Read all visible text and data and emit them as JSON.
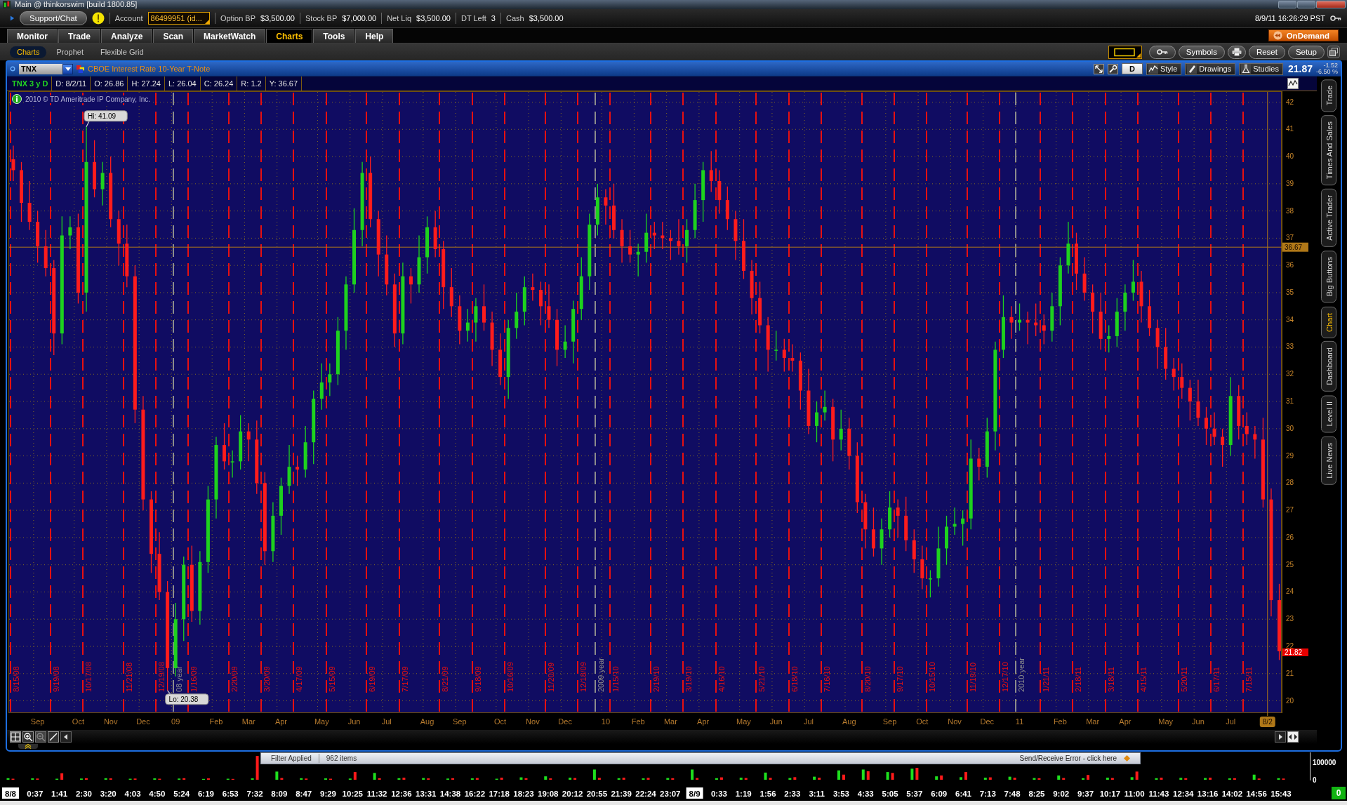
{
  "window": {
    "title": "Main @ thinkorswim [build 1800.85]"
  },
  "account_bar": {
    "support_button": "Support/Chat",
    "account_label": "Account",
    "account_value": "86499951 (id...",
    "stats": [
      {
        "label": "Option BP",
        "value": "$3,500.00"
      },
      {
        "label": "Stock BP",
        "value": "$7,000.00"
      },
      {
        "label": "Net Liq",
        "value": "$3,500.00"
      },
      {
        "label": "DT Left",
        "value": "3"
      },
      {
        "label": "Cash",
        "value": "$3,500.00"
      }
    ],
    "datetime": "8/9/11 16:26:29 PST"
  },
  "tabs": [
    {
      "label": "Monitor",
      "selected": false
    },
    {
      "label": "Trade",
      "selected": false
    },
    {
      "label": "Analyze",
      "selected": false
    },
    {
      "label": "Scan",
      "selected": false
    },
    {
      "label": "MarketWatch",
      "selected": false
    },
    {
      "label": "Charts",
      "selected": true
    },
    {
      "label": "Tools",
      "selected": false
    },
    {
      "label": "Help",
      "selected": false
    }
  ],
  "on_demand_button": "OnDemand",
  "subtabs": [
    {
      "label": "Charts",
      "selected": true
    },
    {
      "label": "Prophet",
      "selected": false
    },
    {
      "label": "Flexible Grid",
      "selected": false
    }
  ],
  "subtab_toolbar": [
    "Symbols",
    "Reset",
    "Setup"
  ],
  "chart_header": {
    "symbol": "TNX",
    "description": "CBOE Interest Rate 10-Year T-Note",
    "aggregation": "D",
    "buttons": [
      {
        "label": "Style",
        "kind": "style"
      },
      {
        "label": "Drawings",
        "kind": "drawings"
      },
      {
        "label": "Studies",
        "kind": "studies"
      }
    ],
    "last_price": "21.87",
    "net_change": "-1.52",
    "percent_change": "-6.50 %"
  },
  "info_bar": {
    "title": "TNX 3 y D",
    "fields": [
      "D: 8/2/11",
      "O: 26.86",
      "H: 27.24",
      "L: 26.04",
      "C: 26.24",
      "R: 1.2",
      "Y: 36.67"
    ]
  },
  "price_chart": {
    "copyright": "2010 © TD Ameritrade IP Company, Inc.",
    "date_lines": [
      {
        "label": "8/15/08",
        "color": "#e81010"
      },
      {
        "label": "9/19/08",
        "color": "#e81010"
      },
      {
        "label": "10/17/08",
        "color": "#e81010"
      },
      {
        "label": "11/21/08",
        "color": "#e81010"
      },
      {
        "label": "12/19/08",
        "color": "#e81010"
      },
      {
        "label": "08 year",
        "color": "#8c8c8c"
      },
      {
        "label": "1/16/09",
        "color": "#e81010"
      },
      {
        "label": "2/20/09",
        "color": "#e81010"
      },
      {
        "label": "3/20/09",
        "color": "#e81010"
      },
      {
        "label": "4/17/09",
        "color": "#e81010"
      },
      {
        "label": "5/15/09",
        "color": "#e81010"
      },
      {
        "label": "6/19/09",
        "color": "#e81010"
      },
      {
        "label": "7/17/09",
        "color": "#e81010"
      },
      {
        "label": "8/21/09",
        "color": "#e81010"
      },
      {
        "label": "9/18/09",
        "color": "#e81010"
      },
      {
        "label": "10/16/09",
        "color": "#e81010"
      },
      {
        "label": "11/20/09",
        "color": "#e81010"
      },
      {
        "label": "12/18/09",
        "color": "#e81010"
      },
      {
        "label": "2009 year",
        "color": "#8c8c8c"
      },
      {
        "label": "1/15/10",
        "color": "#e81010"
      },
      {
        "label": "2/19/10",
        "color": "#e81010"
      },
      {
        "label": "3/19/10",
        "color": "#e81010"
      },
      {
        "label": "4/16/10",
        "color": "#e81010"
      },
      {
        "label": "5/21/10",
        "color": "#e81010"
      },
      {
        "label": "6/18/10",
        "color": "#e81010"
      },
      {
        "label": "7/16/10",
        "color": "#e81010"
      },
      {
        "label": "8/20/10",
        "color": "#e81010"
      },
      {
        "label": "9/17/10",
        "color": "#e81010"
      },
      {
        "label": "10/15/10",
        "color": "#e81010"
      },
      {
        "label": "11/19/10",
        "color": "#e81010"
      },
      {
        "label": "12/17/10",
        "color": "#e81010"
      },
      {
        "label": "2010 year",
        "color": "#8c8c8c"
      },
      {
        "label": "1/21/11",
        "color": "#e81010"
      },
      {
        "label": "2/18/11",
        "color": "#e81010"
      },
      {
        "label": "3/18/11",
        "color": "#e81010"
      },
      {
        "label": "4/15/11",
        "color": "#e81010"
      },
      {
        "label": "5/20/11",
        "color": "#e81010"
      },
      {
        "label": "6/17/11",
        "color": "#e81010"
      },
      {
        "label": "7/15/11",
        "color": "#e81010"
      }
    ],
    "chart_data": {
      "type": "candlestick",
      "grid": true,
      "ylim": [
        19.55,
        42.4
      ],
      "yticks": [
        20,
        21,
        22,
        23,
        24,
        25,
        26,
        27,
        28,
        29,
        30,
        31,
        32,
        33,
        34,
        35,
        36,
        37,
        38,
        39,
        40,
        41,
        42
      ],
      "categories": [
        null,
        null,
        null,
        "Sep",
        null,
        null,
        null,
        null,
        "Oct",
        null,
        null,
        null,
        "Nov",
        null,
        null,
        null,
        "Dec",
        null,
        null,
        null,
        "09",
        null,
        null,
        null,
        null,
        "Feb",
        null,
        null,
        null,
        "Mar",
        null,
        null,
        null,
        "Apr",
        null,
        null,
        null,
        null,
        "May",
        null,
        null,
        null,
        "Jun",
        null,
        null,
        null,
        "Jul",
        null,
        null,
        null,
        null,
        "Aug",
        null,
        null,
        null,
        "Sep",
        null,
        null,
        null,
        null,
        "Oct",
        null,
        null,
        null,
        "Nov",
        null,
        null,
        null,
        "Dec",
        null,
        null,
        null,
        null,
        "10",
        null,
        null,
        null,
        "Feb",
        null,
        null,
        null,
        "Mar",
        null,
        null,
        null,
        "Apr",
        null,
        null,
        null,
        null,
        "May",
        null,
        null,
        null,
        "Jun",
        null,
        null,
        null,
        "Jul",
        null,
        null,
        null,
        null,
        "Aug",
        null,
        null,
        null,
        null,
        "Sep",
        null,
        null,
        null,
        "Oct",
        null,
        null,
        null,
        "Nov",
        null,
        null,
        null,
        "Dec",
        null,
        null,
        null,
        "11",
        null,
        null,
        null,
        null,
        "Feb",
        null,
        null,
        null,
        "Mar",
        null,
        null,
        null,
        "Apr",
        null,
        null,
        null,
        null,
        "May",
        null,
        null,
        null,
        "Jun",
        null,
        null,
        null,
        "Jul",
        null,
        null,
        null,
        null,
        null,
        null
      ],
      "ohlc": [
        [
          39.9,
          40.4,
          39.1,
          39.5
        ],
        [
          39.5,
          39.8,
          37.6,
          38.3
        ],
        [
          38.3,
          39.1,
          37.3,
          37.6
        ],
        [
          37.6,
          38.0,
          36.1,
          36.7
        ],
        [
          36.7,
          37.3,
          35.6,
          35.9
        ],
        [
          35.9,
          36.2,
          32.7,
          33.5
        ],
        [
          33.5,
          37.8,
          33.1,
          37.1
        ],
        [
          37.1,
          37.8,
          36.6,
          37.4
        ],
        [
          37.4,
          37.9,
          34.6,
          35.0
        ],
        [
          35.0,
          41.09,
          34.3,
          39.8
        ],
        [
          39.8,
          40.6,
          38.5,
          38.8
        ],
        [
          38.8,
          39.8,
          38.2,
          39.4
        ],
        [
          39.4,
          40.0,
          37.4,
          37.7
        ],
        [
          37.7,
          38.0,
          36.0,
          36.8
        ],
        [
          36.8,
          37.5,
          35.2,
          35.6
        ],
        [
          35.6,
          36.0,
          30.2,
          30.7
        ],
        [
          30.7,
          31.2,
          27.0,
          27.4
        ],
        [
          27.4,
          27.7,
          24.7,
          25.4
        ],
        [
          25.4,
          26.2,
          23.7,
          24.0
        ],
        [
          24.0,
          24.4,
          20.38,
          21.2
        ],
        [
          21.2,
          23.6,
          20.9,
          23.0
        ],
        [
          23.0,
          25.3,
          22.2,
          25.0
        ],
        [
          25.0,
          25.7,
          22.9,
          23.3
        ],
        [
          23.3,
          25.5,
          22.8,
          25.1
        ],
        [
          25.1,
          27.9,
          24.7,
          27.4
        ],
        [
          27.4,
          29.7,
          26.7,
          29.4
        ],
        [
          29.4,
          30.2,
          28.5,
          28.8
        ],
        [
          28.8,
          29.2,
          28.2,
          28.8
        ],
        [
          28.8,
          30.5,
          28.5,
          29.9
        ],
        [
          29.9,
          30.2,
          28.8,
          29.6
        ],
        [
          29.6,
          30.3,
          27.6,
          28.0
        ],
        [
          28.0,
          28.4,
          25.0,
          25.5
        ],
        [
          25.5,
          27.3,
          25.1,
          26.8
        ],
        [
          26.8,
          28.2,
          26.1,
          27.9
        ],
        [
          27.9,
          29.4,
          27.6,
          28.6
        ],
        [
          28.6,
          29.0,
          27.9,
          28.5
        ],
        [
          28.5,
          30.1,
          28.2,
          29.5
        ],
        [
          29.5,
          31.4,
          28.7,
          31.1
        ],
        [
          31.1,
          32.4,
          30.7,
          31.7
        ],
        [
          31.7,
          32.4,
          31.2,
          32.0
        ],
        [
          32.0,
          34.1,
          31.6,
          33.6
        ],
        [
          33.6,
          35.6,
          32.9,
          35.3
        ],
        [
          35.3,
          38.1,
          35.0,
          37.3
        ],
        [
          37.3,
          39.8,
          36.7,
          39.4
        ],
        [
          39.4,
          40.0,
          37.4,
          37.7
        ],
        [
          37.7,
          38.0,
          35.6,
          36.4
        ],
        [
          36.4,
          37.1,
          34.9,
          35.3
        ],
        [
          35.3,
          35.7,
          33.0,
          33.5
        ],
        [
          33.5,
          36.1,
          33.1,
          35.6
        ],
        [
          35.6,
          35.9,
          34.6,
          35.3
        ],
        [
          35.3,
          37.1,
          35.0,
          36.3
        ],
        [
          36.3,
          37.8,
          35.7,
          37.4
        ],
        [
          37.4,
          38.0,
          36.3,
          36.6
        ],
        [
          36.6,
          36.9,
          34.4,
          35.2
        ],
        [
          35.2,
          35.9,
          34.1,
          34.5
        ],
        [
          34.5,
          34.9,
          33.1,
          33.6
        ],
        [
          33.6,
          34.4,
          33.2,
          33.9
        ],
        [
          33.9,
          34.8,
          33.2,
          34.5
        ],
        [
          34.5,
          35.3,
          33.6,
          33.9
        ],
        [
          33.9,
          34.3,
          32.3,
          32.9
        ],
        [
          32.9,
          33.5,
          31.6,
          31.9
        ],
        [
          31.9,
          34.0,
          31.1,
          33.7
        ],
        [
          33.7,
          35.0,
          33.3,
          34.3
        ],
        [
          34.3,
          35.6,
          33.8,
          35.2
        ],
        [
          35.2,
          35.7,
          34.7,
          35.1
        ],
        [
          35.1,
          35.4,
          33.8,
          34.5
        ],
        [
          34.5,
          35.3,
          33.7,
          34.0
        ],
        [
          34.0,
          34.4,
          32.3,
          32.9
        ],
        [
          32.9,
          33.8,
          32.6,
          33.2
        ],
        [
          33.2,
          34.7,
          32.4,
          34.4
        ],
        [
          34.4,
          36.3,
          34.0,
          35.6
        ],
        [
          35.6,
          37.9,
          35.1,
          37.5
        ],
        [
          37.5,
          39.0,
          37.1,
          38.5
        ],
        [
          38.5,
          38.8,
          37.5,
          38.2
        ],
        [
          38.2,
          39.0,
          37.0,
          37.3
        ],
        [
          37.3,
          37.7,
          36.1,
          36.7
        ],
        [
          36.7,
          37.3,
          36.1,
          36.4
        ],
        [
          36.4,
          36.8,
          35.6,
          36.5
        ],
        [
          36.5,
          37.9,
          36.1,
          37.2
        ],
        [
          37.2,
          37.6,
          36.6,
          37.1
        ],
        [
          37.1,
          37.6,
          36.6,
          37.0
        ],
        [
          37.0,
          37.3,
          36.2,
          36.9
        ],
        [
          36.9,
          37.7,
          36.4,
          36.7
        ],
        [
          36.7,
          37.7,
          36.1,
          37.3
        ],
        [
          37.3,
          39.0,
          37.0,
          38.4
        ],
        [
          38.4,
          39.8,
          37.6,
          39.5
        ],
        [
          39.5,
          40.2,
          38.7,
          39.1
        ],
        [
          39.1,
          39.5,
          37.9,
          38.4
        ],
        [
          38.4,
          38.9,
          37.3,
          37.7
        ],
        [
          37.7,
          38.0,
          36.2,
          36.9
        ],
        [
          36.9,
          37.7,
          35.5,
          35.8
        ],
        [
          35.8,
          36.2,
          34.2,
          34.8
        ],
        [
          34.8,
          35.4,
          33.5,
          33.8
        ],
        [
          33.8,
          34.1,
          32.1,
          32.9
        ],
        [
          32.9,
          33.6,
          32.5,
          32.9
        ],
        [
          32.9,
          33.3,
          32.1,
          32.6
        ],
        [
          32.6,
          33.1,
          32.1,
          32.5
        ],
        [
          32.5,
          32.8,
          30.7,
          31.4
        ],
        [
          31.4,
          32.2,
          29.8,
          30.1
        ],
        [
          30.1,
          31.0,
          29.5,
          30.6
        ],
        [
          30.6,
          31.4,
          30.3,
          30.8
        ],
        [
          30.8,
          31.1,
          28.8,
          29.6
        ],
        [
          29.6,
          30.7,
          29.2,
          30.0
        ],
        [
          30.0,
          30.4,
          28.5,
          29.0
        ],
        [
          29.0,
          29.5,
          26.9,
          27.3
        ],
        [
          27.3,
          27.6,
          25.6,
          26.3
        ],
        [
          26.3,
          27.1,
          25.3,
          25.6
        ],
        [
          25.6,
          26.7,
          25.0,
          26.3
        ],
        [
          26.3,
          27.7,
          26.0,
          27.1
        ],
        [
          27.1,
          27.4,
          26.0,
          26.8
        ],
        [
          26.8,
          27.5,
          25.5,
          25.9
        ],
        [
          25.9,
          26.3,
          24.7,
          25.2
        ],
        [
          25.2,
          25.7,
          24.1,
          24.5
        ],
        [
          24.5,
          24.8,
          23.8,
          24.5
        ],
        [
          24.5,
          26.4,
          24.2,
          25.6
        ],
        [
          25.6,
          26.8,
          25.0,
          26.4
        ],
        [
          26.4,
          27.1,
          26.1,
          26.5
        ],
        [
          26.5,
          27.0,
          25.7,
          26.7
        ],
        [
          26.7,
          29.6,
          26.3,
          28.9
        ],
        [
          28.9,
          29.3,
          28.1,
          28.6
        ],
        [
          28.6,
          30.4,
          28.2,
          29.9
        ],
        [
          29.9,
          33.2,
          29.2,
          32.9
        ],
        [
          32.9,
          34.9,
          32.6,
          34.1
        ],
        [
          34.1,
          34.5,
          33.3,
          33.9
        ],
        [
          33.9,
          34.6,
          33.6,
          34.0
        ],
        [
          34.0,
          34.3,
          33.1,
          33.9
        ],
        [
          33.9,
          34.6,
          33.4,
          33.8
        ],
        [
          33.8,
          34.2,
          33.1,
          33.6
        ],
        [
          33.6,
          35.0,
          33.2,
          34.5
        ],
        [
          34.5,
          36.3,
          33.8,
          36.0
        ],
        [
          36.0,
          37.6,
          35.7,
          36.8
        ],
        [
          36.8,
          37.2,
          35.1,
          35.7
        ],
        [
          35.7,
          36.3,
          34.7,
          35.0
        ],
        [
          35.0,
          35.3,
          33.5,
          34.3
        ],
        [
          34.3,
          35.0,
          32.9,
          33.3
        ],
        [
          33.3,
          33.8,
          32.8,
          33.4
        ],
        [
          33.4,
          34.8,
          33.0,
          34.3
        ],
        [
          34.3,
          35.3,
          33.6,
          35.0
        ],
        [
          35.0,
          36.2,
          34.7,
          35.4
        ],
        [
          35.4,
          35.8,
          33.9,
          34.5
        ],
        [
          34.5,
          35.1,
          33.4,
          33.7
        ],
        [
          33.7,
          34.0,
          32.2,
          33.0
        ],
        [
          33.0,
          33.7,
          31.8,
          32.2
        ],
        [
          32.2,
          32.6,
          31.4,
          31.9
        ],
        [
          31.9,
          32.4,
          31.1,
          31.5
        ],
        [
          31.5,
          31.8,
          30.3,
          31.0
        ],
        [
          31.0,
          31.8,
          30.1,
          30.4
        ],
        [
          30.4,
          30.8,
          29.4,
          30.0
        ],
        [
          30.0,
          30.6,
          29.4,
          29.7
        ],
        [
          29.7,
          30.0,
          28.6,
          29.4
        ],
        [
          29.4,
          31.9,
          29.0,
          31.2
        ],
        [
          31.2,
          31.6,
          29.6,
          30.1
        ],
        [
          30.1,
          30.6,
          29.4,
          29.8
        ],
        [
          29.8,
          30.1,
          28.9,
          29.6
        ],
        [
          29.6,
          30.4,
          27.1,
          27.4
        ],
        [
          27.4,
          27.8,
          23.1,
          23.7
        ],
        [
          23.7,
          24.3,
          21.5,
          21.82
        ]
      ],
      "ref_lines": [
        {
          "axis": "y",
          "value": 36.67,
          "label": "36.67",
          "color": "#b07818"
        }
      ],
      "annotations": [
        "Hi: 41.09",
        "Lo: 20.38",
        "8/2",
        "21.82"
      ]
    }
  },
  "side_tabs": [
    {
      "label": "Trade",
      "selected": false
    },
    {
      "label": "Times And Sales",
      "selected": false
    },
    {
      "label": "Active Trader",
      "selected": false
    },
    {
      "label": "Big Buttons",
      "selected": false
    },
    {
      "label": "Chart",
      "selected": true
    },
    {
      "label": "Dashboard",
      "selected": false
    },
    {
      "label": "Level II",
      "selected": false
    },
    {
      "label": "Live News",
      "selected": false
    }
  ],
  "status_popup": {
    "filter_label": "Filter Applied",
    "item_count": "962 items",
    "error_link": "Send/Receive Error - click here"
  },
  "volume_chart": {
    "chart_data": {
      "type": "bar",
      "categories": [
        "8/8",
        "0:37",
        "1:41",
        "2:30",
        "3:20",
        "4:03",
        "4:50",
        "5:24",
        "6:19",
        "6:53",
        "7:32",
        "8:09",
        "8:47",
        "9:29",
        "10:25",
        "11:32",
        "12:36",
        "13:31",
        "14:38",
        "16:22",
        "17:18",
        "18:23",
        "19:08",
        "20:12",
        "20:55",
        "21:39",
        "22:24",
        "23:07",
        "8/9",
        "0:33",
        "1:19",
        "1:56",
        "2:33",
        "3:11",
        "3:53",
        "4:33",
        "5:05",
        "5:37",
        "6:09",
        "6:41",
        "7:13",
        "7:48",
        "8:25",
        "9:02",
        "9:37",
        "10:17",
        "11:00",
        "11:43",
        "12:34",
        "13:16",
        "14:02",
        "14:56",
        "15:43"
      ],
      "ylim": [
        0,
        165000
      ],
      "yticks": [
        0,
        100000
      ],
      "series": [
        {
          "color": "#1ee01e",
          "values": [
            9000,
            8000,
            6000,
            7000,
            9000,
            6000,
            8000,
            7000,
            5000,
            6000,
            8000,
            48000,
            9000,
            8000,
            7000,
            40000,
            9000,
            10000,
            7000,
            8000,
            6000,
            14000,
            20000,
            12000,
            60000,
            9000,
            8000,
            10000,
            60000,
            9000,
            12000,
            42000,
            10000,
            18000,
            55000,
            60000,
            45000,
            65000,
            20000,
            15000,
            12000,
            18000,
            10000,
            25000,
            9000,
            12000,
            15000,
            9000,
            11000,
            10000,
            8000,
            30000,
            9000
          ]
        },
        {
          "color": "#ff1a1a",
          "values": [
            6000,
            7000,
            38000,
            9000,
            8000,
            7000,
            6000,
            9000,
            8000,
            5000,
            140000,
            10000,
            7000,
            6000,
            45000,
            9000,
            12000,
            8000,
            9000,
            10000,
            12000,
            9000,
            8000,
            10000,
            11000,
            12000,
            11000,
            9000,
            10000,
            14000,
            10000,
            11000,
            15000,
            12000,
            30000,
            50000,
            40000,
            70000,
            25000,
            45000,
            14000,
            12000,
            9000,
            10000,
            28000,
            10000,
            48000,
            12000,
            9000,
            12000,
            9000,
            7000,
            7000
          ]
        }
      ]
    }
  },
  "connection_count": "0"
}
